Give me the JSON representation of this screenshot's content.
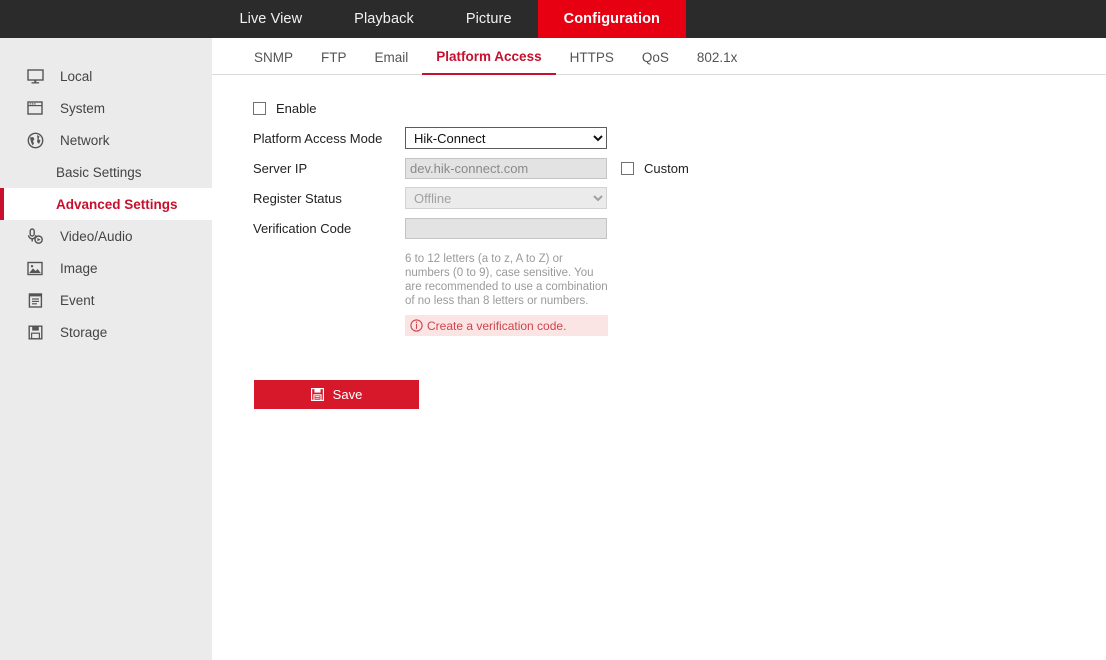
{
  "header": {
    "nav_tabs": [
      {
        "label": "Live View",
        "active": false
      },
      {
        "label": "Playback",
        "active": false
      },
      {
        "label": "Picture",
        "active": false
      },
      {
        "label": "Configuration",
        "active": true
      }
    ]
  },
  "sidebar": {
    "items": [
      {
        "label": "Local",
        "icon": "monitor-icon",
        "type": "top"
      },
      {
        "label": "System",
        "icon": "window-icon",
        "type": "top"
      },
      {
        "label": "Network",
        "icon": "globe-icon",
        "type": "top"
      },
      {
        "label": "Basic Settings",
        "icon": "",
        "type": "sub",
        "active": false
      },
      {
        "label": "Advanced Settings",
        "icon": "",
        "type": "sub",
        "active": true
      },
      {
        "label": "Video/Audio",
        "icon": "audio-video-icon",
        "type": "top"
      },
      {
        "label": "Image",
        "icon": "image-icon",
        "type": "top"
      },
      {
        "label": "Event",
        "icon": "event-icon",
        "type": "top"
      },
      {
        "label": "Storage",
        "icon": "storage-icon",
        "type": "top"
      }
    ]
  },
  "content": {
    "tabs": [
      {
        "label": "SNMP",
        "active": false
      },
      {
        "label": "FTP",
        "active": false
      },
      {
        "label": "Email",
        "active": false
      },
      {
        "label": "Platform Access",
        "active": true
      },
      {
        "label": "HTTPS",
        "active": false
      },
      {
        "label": "QoS",
        "active": false
      },
      {
        "label": "802.1x",
        "active": false
      }
    ],
    "form": {
      "enable": {
        "label": "Enable",
        "checked": false
      },
      "platform_access_mode": {
        "label": "Platform Access Mode",
        "value": "Hik-Connect",
        "options": [
          "Hik-Connect"
        ],
        "disabled": false
      },
      "server_ip": {
        "label": "Server IP",
        "value": "",
        "placeholder": "dev.hik-connect.com",
        "disabled": true
      },
      "custom": {
        "label": "Custom",
        "checked": false
      },
      "register_status": {
        "label": "Register Status",
        "value": "Offline",
        "options": [
          "Offline"
        ],
        "disabled": true
      },
      "verification_code": {
        "label": "Verification Code",
        "value": "",
        "placeholder": "",
        "disabled": true
      },
      "hint": "6 to 12 letters (a to z, A to Z) or numbers (0 to 9), case sensitive. You are recommended to use a combination of no less than 8 letters or numbers.",
      "error": {
        "icon": "info-circle-icon",
        "text": "Create a verification code."
      },
      "save_button": {
        "label": "Save",
        "icon": "floppy-save-icon"
      }
    }
  },
  "colors": {
    "brand_red": "#e60012",
    "accent_red": "#c8102e",
    "button_red": "#d7182a",
    "header_dark": "#2b2b2b",
    "sidebar_bg": "#ebebeb",
    "error_bg": "#fbe4e4",
    "error_text": "#d0434c"
  }
}
